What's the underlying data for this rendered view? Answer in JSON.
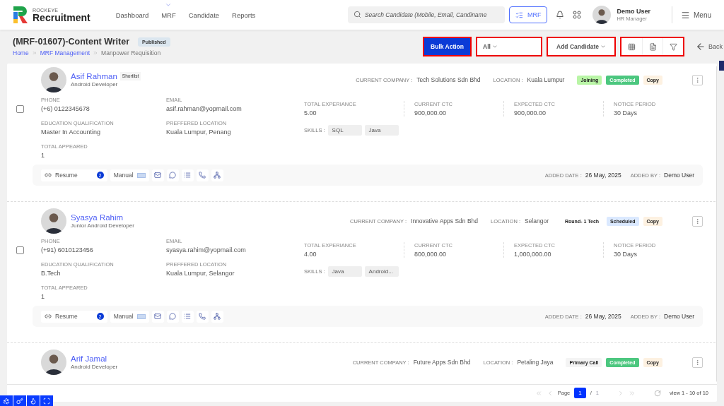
{
  "header": {
    "brand_top": "ROCKEYE",
    "brand": "Recruitment",
    "nav": [
      {
        "label": "Dashboard",
        "kind": "link"
      },
      {
        "label": "MRF",
        "kind": "dropdown"
      },
      {
        "label": "Candidate",
        "kind": "link"
      },
      {
        "label": "Reports",
        "kind": "link"
      }
    ],
    "search": {
      "placeholder": "Search Candidate (Mobile, Email, Candiname"
    },
    "mrf_button": "MRF",
    "user": {
      "name": "Demo User",
      "role": "HR Manager"
    },
    "menu": "Menu"
  },
  "page": {
    "title": "(MRF-01607)-Content Writer",
    "status": "Published",
    "breadcrumb": [
      "Home",
      "MRF Management",
      "Manpower Requisition"
    ]
  },
  "toolbar": {
    "bulk_action": "Bulk Action",
    "filter": {
      "value": "All"
    },
    "add_candidate": "Add Candidate",
    "back": "Back"
  },
  "candidates": [
    {
      "name": "Asif Rahman",
      "tag": "Shortlist",
      "role": "Android Developer",
      "company_label": "CURRENT COMPANY :",
      "company": "Tech Solutions Sdn Bhd",
      "location_label": "LOCATION :",
      "location": "Kuala Lumpur",
      "stage": {
        "label": "Joining",
        "color": "#b9f5a6"
      },
      "status": {
        "label": "Completed",
        "color": "#4cc77f"
      },
      "copy": "Copy",
      "checked": false,
      "fields": [
        {
          "label": "PHONE",
          "value": "(+6) 0122345678"
        },
        {
          "label": "EMAIL",
          "value": "asif.rahman@yopmail.com"
        },
        {
          "label": "EDUCATION QUALIFICATION",
          "value": "Master In Accounting"
        },
        {
          "label": "PREFFERED LOCATION",
          "value": "Kuala Lumpur, Penang"
        },
        {
          "label": "TOTAL APPEARED",
          "value": "1"
        }
      ],
      "stats": [
        {
          "label": "TOTAL EXPERIANCE",
          "value": "5.00"
        },
        {
          "label": "CURRENT CTC",
          "value": "900,000.00"
        },
        {
          "label": "EXPECTED CTC",
          "value": "900,000.00"
        },
        {
          "label": "NOTICE PERIOD",
          "value": "30 Days"
        }
      ],
      "skills_label": "SKILLS :",
      "skills": [
        "SQL",
        "Java"
      ],
      "actions": {
        "resume": "Resume",
        "resume_count": "2",
        "manual": "Manual"
      },
      "added_date_label": "ADDED DATE :",
      "added_date": "26 May, 2025",
      "added_by_label": "ADDED BY :",
      "added_by": "Demo User"
    },
    {
      "name": "Syasya Rahim",
      "role": "Junior Android Developer",
      "company_label": "CURRENT COMPANY :",
      "company": "Innovative Apps Sdn Bhd",
      "location_label": "LOCATION :",
      "location": "Selangor",
      "stage": {
        "label": "Round- 1 Tech",
        "color": "#ffffff"
      },
      "status": {
        "label": "Scheduled",
        "color": "#dbe9ff"
      },
      "copy": "Copy",
      "checked": false,
      "fields": [
        {
          "label": "PHONE",
          "value": "(+91) 6010123456"
        },
        {
          "label": "EMAIL",
          "value": "syasya.rahim@yopmail.com"
        },
        {
          "label": "EDUCATION QUALIFICATION",
          "value": "B.Tech"
        },
        {
          "label": "PREFFERED LOCATION",
          "value": "Kuala Lumpur, Selangor"
        },
        {
          "label": "TOTAL APPEARED",
          "value": "1"
        }
      ],
      "stats": [
        {
          "label": "TOTAL EXPERIANCE",
          "value": "4.00"
        },
        {
          "label": "CURRENT CTC",
          "value": "800,000.00"
        },
        {
          "label": "EXPECTED CTC",
          "value": "1,000,000.00"
        },
        {
          "label": "NOTICE PERIOD",
          "value": "30 Days"
        }
      ],
      "skills_label": "SKILLS :",
      "skills": [
        "Java",
        "Android..."
      ],
      "actions": {
        "resume": "Resume",
        "resume_count": "2",
        "manual": "Manual"
      },
      "added_date_label": "ADDED DATE :",
      "added_date": "26 May, 2025",
      "added_by_label": "ADDED BY :",
      "added_by": "Demo User"
    },
    {
      "name": "Arif Jamal",
      "role": "Android Developer",
      "company_label": "CURRENT COMPANY :",
      "company": "Future Apps Sdn Bhd",
      "location_label": "LOCATION :",
      "location": "Petaling Jaya",
      "stage": {
        "label": "Primary Call",
        "color": "#f4f4f4"
      },
      "status": {
        "label": "Completed",
        "color": "#4cc77f"
      },
      "copy": "Copy"
    }
  ],
  "pagination": {
    "page_label": "Page",
    "page": "1",
    "separator": "/",
    "total": "1",
    "view": "view 1 - 10 of 10"
  }
}
